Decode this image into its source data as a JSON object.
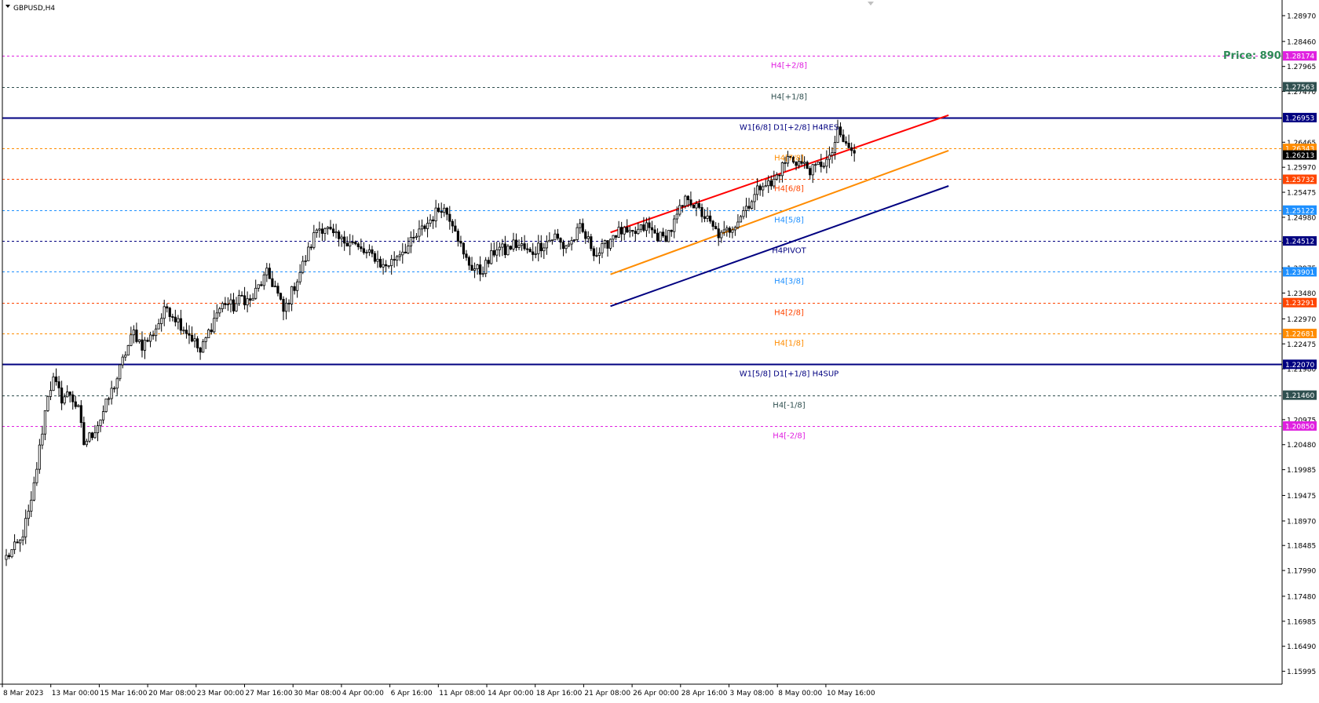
{
  "symbol": "GBPUSD,H4",
  "price_marker": {
    "text": "Price: 890",
    "color": "#2e8b57",
    "price": 1.28174
  },
  "colors": {
    "bull": "#000000",
    "bear": "#000000",
    "bg": "#ffffff",
    "axis": "#000000"
  },
  "chart_data": {
    "type": "candlestick",
    "timeframe": "H4",
    "ylim": [
      1.1574,
      1.2928
    ],
    "y_ticks": [
      "1.28970",
      "1.28460",
      "1.27965",
      "1.27470",
      "1.26465",
      "1.25970",
      "1.25475",
      "1.24980",
      "1.24475",
      "1.23975",
      "1.23480",
      "1.22970",
      "1.22475",
      "1.21980",
      "1.20975",
      "1.20480",
      "1.19985",
      "1.19475",
      "1.18970",
      "1.18485",
      "1.17990",
      "1.17480",
      "1.16985",
      "1.16490",
      "1.15995"
    ],
    "x_ticks": [
      "8 Mar 2023",
      "13 Mar 00:00",
      "15 Mar 16:00",
      "20 Mar 08:00",
      "23 Mar 00:00",
      "27 Mar 16:00",
      "30 Mar 08:00",
      "4 Apr 00:00",
      "6 Apr 16:00",
      "11 Apr 08:00",
      "14 Apr 00:00",
      "18 Apr 16:00",
      "21 Apr 08:00",
      "26 Apr 00:00",
      "28 Apr 16:00",
      "3 May 08:00",
      "8 May 00:00",
      "10 May 16:00"
    ],
    "x_index_range": [
      0,
      340
    ],
    "anchors": [
      [
        0,
        1.1825
      ],
      [
        5,
        1.1855
      ],
      [
        9,
        1.193
      ],
      [
        12,
        1.204
      ],
      [
        15,
        1.215
      ],
      [
        17,
        1.2175
      ],
      [
        20,
        1.214
      ],
      [
        23,
        1.215
      ],
      [
        26,
        1.2115
      ],
      [
        28,
        1.205
      ],
      [
        31,
        1.207
      ],
      [
        34,
        1.21
      ],
      [
        37,
        1.214
      ],
      [
        40,
        1.218
      ],
      [
        43,
        1.223
      ],
      [
        46,
        1.227
      ],
      [
        49,
        1.2245
      ],
      [
        52,
        1.226
      ],
      [
        55,
        1.229
      ],
      [
        58,
        1.232
      ],
      [
        61,
        1.23
      ],
      [
        64,
        1.228
      ],
      [
        67,
        1.226
      ],
      [
        70,
        1.223
      ],
      [
        73,
        1.227
      ],
      [
        76,
        1.231
      ],
      [
        79,
        1.233
      ],
      [
        82,
        1.232
      ],
      [
        85,
        1.234
      ],
      [
        88,
        1.233
      ],
      [
        91,
        1.236
      ],
      [
        94,
        1.2385
      ],
      [
        97,
        1.236
      ],
      [
        100,
        1.231
      ],
      [
        103,
        1.235
      ],
      [
        106,
        1.239
      ],
      [
        109,
        1.243
      ],
      [
        112,
        1.2475
      ],
      [
        115,
        1.248
      ],
      [
        118,
        1.246
      ],
      [
        121,
        1.245
      ],
      [
        124,
        1.2455
      ],
      [
        127,
        1.2435
      ],
      [
        130,
        1.2425
      ],
      [
        133,
        1.242
      ],
      [
        136,
        1.24
      ],
      [
        139,
        1.241
      ],
      [
        142,
        1.243
      ],
      [
        145,
        1.244
      ],
      [
        148,
        1.246
      ],
      [
        151,
        1.248
      ],
      [
        154,
        1.25
      ],
      [
        157,
        1.252
      ],
      [
        160,
        1.25
      ],
      [
        162,
        1.248
      ],
      [
        165,
        1.242
      ],
      [
        168,
        1.24
      ],
      [
        171,
        1.239
      ],
      [
        174,
        1.241
      ],
      [
        177,
        1.244
      ],
      [
        180,
        1.243
      ],
      [
        183,
        1.2445
      ],
      [
        186,
        1.244
      ],
      [
        189,
        1.2425
      ],
      [
        192,
        1.244
      ],
      [
        195,
        1.245
      ],
      [
        198,
        1.246
      ],
      [
        201,
        1.244
      ],
      [
        204,
        1.245
      ],
      [
        207,
        1.2475
      ],
      [
        210,
        1.245
      ],
      [
        213,
        1.2425
      ],
      [
        216,
        1.244
      ],
      [
        219,
        1.2465
      ],
      [
        222,
        1.247
      ],
      [
        225,
        1.246
      ],
      [
        228,
        1.247
      ],
      [
        231,
        1.248
      ],
      [
        234,
        1.2465
      ],
      [
        237,
        1.2455
      ],
      [
        240,
        1.2475
      ],
      [
        243,
        1.251
      ],
      [
        246,
        1.254
      ],
      [
        249,
        1.2515
      ],
      [
        252,
        1.25
      ],
      [
        255,
        1.2475
      ],
      [
        258,
        1.246
      ],
      [
        261,
        1.2475
      ],
      [
        264,
        1.2495
      ],
      [
        267,
        1.252
      ],
      [
        270,
        1.254
      ],
      [
        273,
        1.257
      ],
      [
        276,
        1.256
      ],
      [
        279,
        1.259
      ],
      [
        282,
        1.2615
      ],
      [
        285,
        1.261
      ],
      [
        288,
        1.26
      ],
      [
        291,
        1.259
      ],
      [
        294,
        1.2605
      ],
      [
        297,
        1.261
      ],
      [
        300,
        1.2665
      ],
      [
        303,
        1.264
      ],
      [
        306,
        1.2625
      ]
    ],
    "murrey_levels": [
      {
        "label": "H4[+2/8]",
        "price": 1.28174,
        "color": "#e020e0",
        "line": "dash",
        "price_label": "1.28174"
      },
      {
        "label": "H4[+1/8]",
        "price": 1.27563,
        "color": "#2f4f4f",
        "line": "dash",
        "price_label": "1.27563"
      },
      {
        "label": "W1[6/8] D1[+2/8] H4RES",
        "price": 1.26953,
        "color": "#000080",
        "line": "solid",
        "price_label": "1.26953"
      },
      {
        "label": "H4[7/8]",
        "price": 1.26343,
        "color": "#ff8c00",
        "line": "dash",
        "price_label": "1.26343"
      },
      {
        "label": "H4[6/8]",
        "price": 1.25732,
        "color": "#ff4500",
        "line": "dash",
        "price_label": "1.25732"
      },
      {
        "label": "H4[5/8]",
        "price": 1.25122,
        "color": "#1e90ff",
        "line": "dash",
        "price_label": "1.25122"
      },
      {
        "label": "H4PIVOT",
        "price": 1.24512,
        "color": "#000080",
        "line": "dash",
        "price_label": "1.24512"
      },
      {
        "label": "H4[3/8]",
        "price": 1.23901,
        "color": "#1e90ff",
        "line": "dash",
        "price_label": "1.23901"
      },
      {
        "label": "H4[2/8]",
        "price": 1.23291,
        "color": "#ff4500",
        "line": "dash",
        "price_label": "1.23291"
      },
      {
        "label": "H4[1/8]",
        "price": 1.22681,
        "color": "#ff8c00",
        "line": "dash",
        "price_label": "1.22681"
      },
      {
        "label": "W1[5/8] D1[+1/8] H4SUP",
        "price": 1.2207,
        "color": "#000080",
        "line": "solid",
        "price_label": "1.22070"
      },
      {
        "label": "H4[-1/8]",
        "price": 1.2146,
        "color": "#2f4f4f",
        "line": "dash",
        "price_label": "1.21460"
      },
      {
        "label": "H4[-2/8]",
        "price": 1.2085,
        "color": "#e020e0",
        "line": "dash",
        "price_label": "1.20850"
      }
    ],
    "current_price": {
      "price": 1.26213,
      "price_label": "1.26213",
      "color": "#000000"
    },
    "channel": {
      "upper": {
        "x": [
          218,
          340
        ],
        "y": [
          1.2468,
          1.27
        ],
        "color": "#ff0000"
      },
      "middle": {
        "x": [
          218,
          340
        ],
        "y": [
          1.2385,
          1.263
        ],
        "color": "#ff8c00"
      },
      "lower": {
        "x": [
          218,
          340
        ],
        "y": [
          1.2322,
          1.256
        ],
        "color": "#000080"
      }
    }
  }
}
